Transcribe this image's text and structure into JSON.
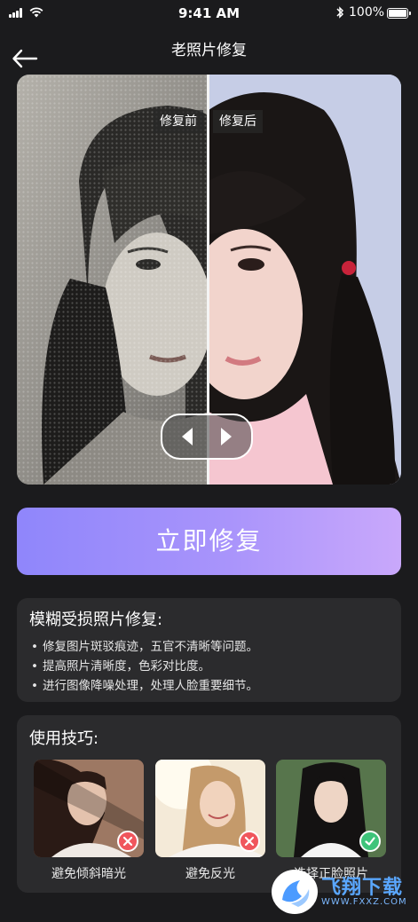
{
  "status_bar": {
    "time": "9:41 AM",
    "battery": "100%"
  },
  "header": {
    "title": "老照片修复",
    "back_icon": "arrow-left-icon"
  },
  "comparison": {
    "before_label": "修复前",
    "after_label": "修复后",
    "slider_position": 0.5,
    "handle_icons": [
      "triangle-left-icon",
      "triangle-right-icon"
    ]
  },
  "action": {
    "repair_label": "立即修复",
    "gradient": [
      "#8f86fb",
      "#c9a8fb"
    ]
  },
  "info": {
    "title": "模糊受损照片修复:",
    "items": [
      "修复图片斑驳痕迹，五官不清晰等问题。",
      "提高照片清晰度，色彩对比度。",
      "进行图像降噪处理，处理人脸重要细节。"
    ]
  },
  "tips": {
    "title": "使用技巧:",
    "items": [
      {
        "label": "避免倾斜暗光",
        "status": "bad",
        "icon": "close-icon"
      },
      {
        "label": "避免反光",
        "status": "bad",
        "icon": "close-icon"
      },
      {
        "label": "选择正脸照片",
        "status": "good",
        "icon": "check-icon"
      }
    ]
  },
  "watermark": {
    "text": "飞翔下载",
    "url": "WWW.FXXZ.COM"
  },
  "colors": {
    "background": "#1b1b1d",
    "card": "#2b2b2d",
    "bad": "#f0565d",
    "good": "#3ec47a"
  }
}
